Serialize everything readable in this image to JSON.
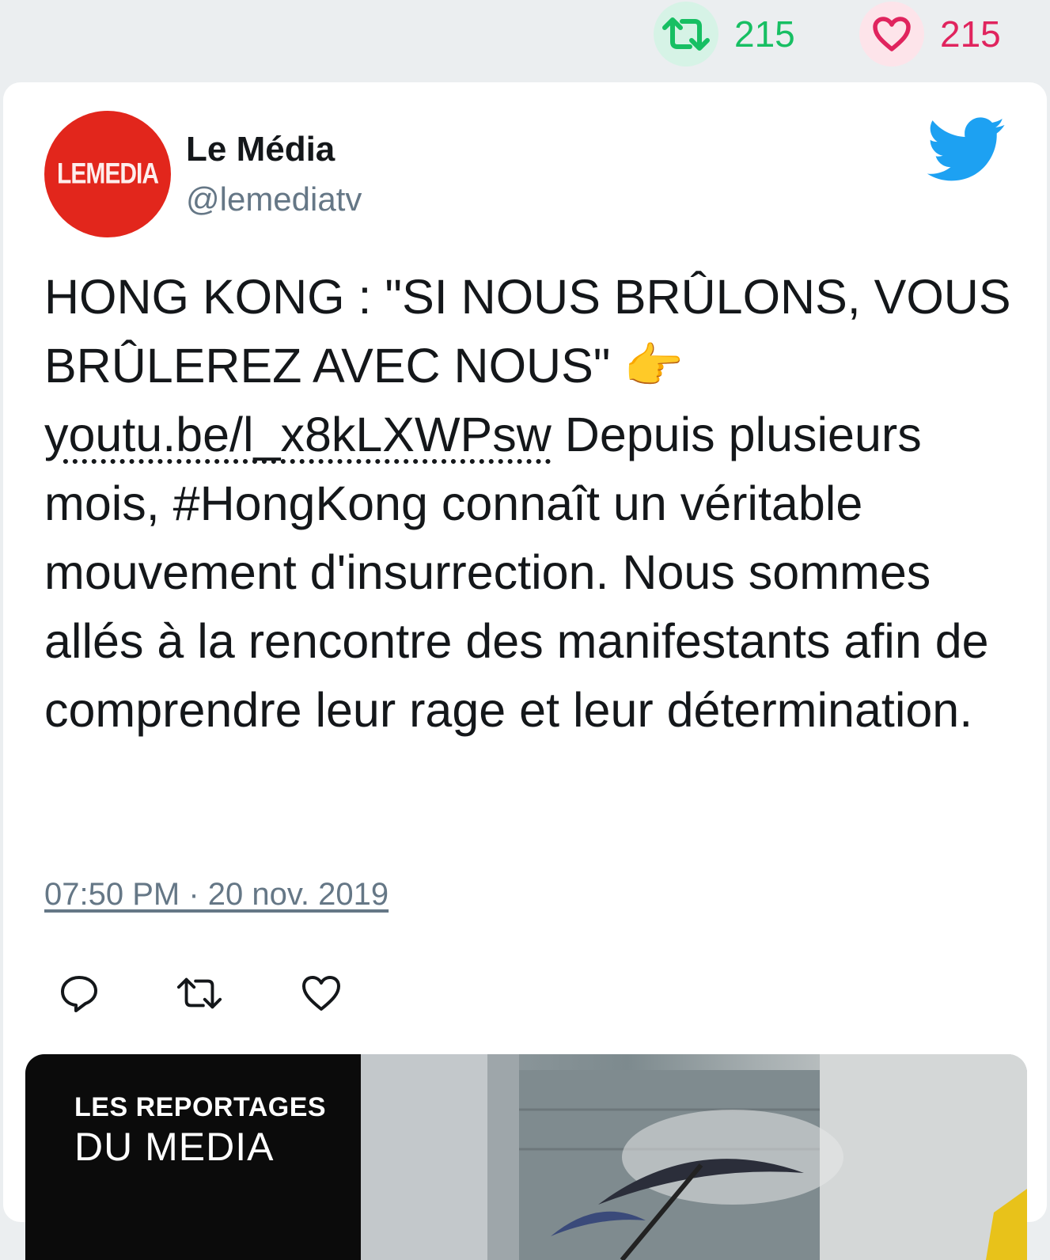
{
  "stats": {
    "retweet_count": "215",
    "like_count": "215"
  },
  "author": {
    "avatar_text": "LEMEDIA",
    "display_name": "Le Média",
    "handle": "@lemediatv"
  },
  "tweet": {
    "text_before_link": "HONG KONG : \"SI NOUS BRÛLONS, VOUS BRÛLEREZ AVEC NOUS\" 👉 ",
    "link_text": "youtu.be/l_x8kLXWPsw",
    "text_after_link": " Depuis plusieurs mois, #HongKong connaît un véritable mouvement d'insurrection. Nous sommes allés à la rencontre des manifestants afin de comprendre leur rage et leur détermination.",
    "timestamp": "07:50 PM · 20 nov. 2019"
  },
  "media": {
    "banner_line1": "LES REPORTAGES",
    "banner_line2": "DU MEDIA"
  },
  "colors": {
    "retweet_green": "#17bf63",
    "like_pink": "#e0245e",
    "twitter_blue": "#1da1f2",
    "avatar_red": "#e2261c"
  },
  "icons": {
    "retweet": "retweet-icon",
    "like": "heart-icon",
    "reply": "reply-icon",
    "brand": "twitter-bird-icon"
  }
}
